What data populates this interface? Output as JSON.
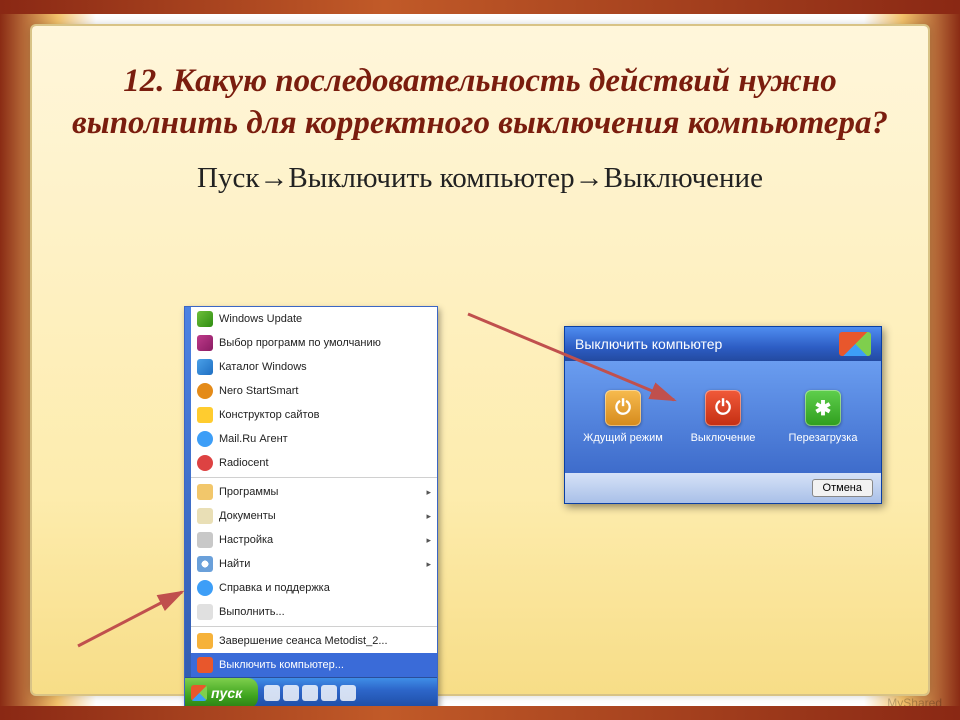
{
  "question": "12. Какую последовательность действий нужно выполнить для корректного выключения компьютера?",
  "answer": "Пуск→Выключить компьютер→Выключение",
  "startmenu": {
    "items_top": [
      {
        "label": "Windows Update",
        "icon": "update"
      },
      {
        "label": "Выбор программ по умолчанию",
        "icon": "defprog"
      },
      {
        "label": "Каталог Windows",
        "icon": "catalog"
      },
      {
        "label": "Nero StartSmart",
        "icon": "nero"
      },
      {
        "label": "Конструктор сайтов",
        "icon": "sites"
      },
      {
        "label": "Mail.Ru Агент",
        "icon": "mailru"
      },
      {
        "label": "Radiocent",
        "icon": "radio"
      }
    ],
    "items_sys": [
      {
        "label": "Программы",
        "icon": "progs",
        "sub": true
      },
      {
        "label": "Документы",
        "icon": "docs",
        "sub": true
      },
      {
        "label": "Настройка",
        "icon": "settings",
        "sub": true
      },
      {
        "label": "Найти",
        "icon": "search",
        "sub": true
      },
      {
        "label": "Справка и поддержка",
        "icon": "help"
      },
      {
        "label": "Выполнить...",
        "icon": "run"
      }
    ],
    "items_bottom": [
      {
        "label": "Завершение сеанса Metodist_2...",
        "icon": "logoff"
      },
      {
        "label": "Выключить компьютер...",
        "icon": "shutdown",
        "highlight": true
      }
    ],
    "start_label": "пуск"
  },
  "dialog": {
    "title": "Выключить компьютер",
    "options": [
      {
        "label": "Ждущий режим",
        "kind": "standby",
        "glyph": "⏻"
      },
      {
        "label": "Выключение",
        "kind": "off",
        "glyph": "⏻"
      },
      {
        "label": "Перезагрузка",
        "kind": "restart",
        "glyph": "✱"
      }
    ],
    "cancel": "Отмена"
  },
  "signature": "MyShared"
}
